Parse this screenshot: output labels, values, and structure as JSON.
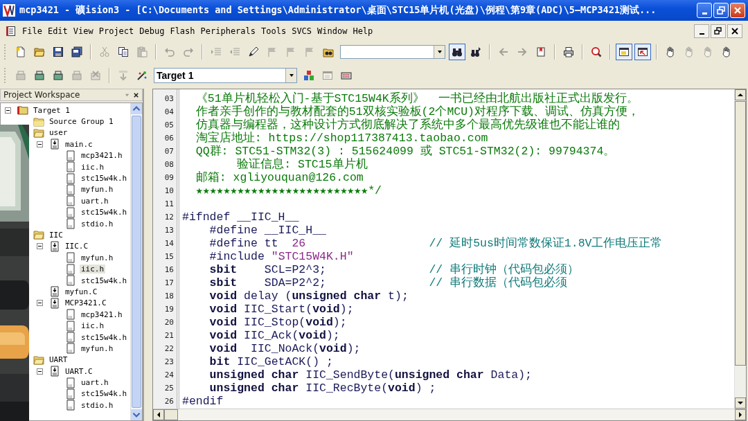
{
  "window": {
    "title": "mcp3421  - 礦ision3 - [C:\\Documents and Settings\\Administrator\\桌面\\STC15单片机(光盘)\\例程\\第9章(ADC)\\5—MCP3421测试..."
  },
  "menu": [
    "File",
    "Edit",
    "View",
    "Project",
    "Debug",
    "Flash",
    "Peripherals",
    "Tools",
    "SVCS",
    "Window",
    "Help"
  ],
  "toolbars": [
    [
      [
        {
          "kind": "new",
          "pressed": false,
          "disabled": false
        },
        {
          "kind": "open",
          "pressed": false,
          "disabled": false
        },
        {
          "kind": "save",
          "pressed": false,
          "disabled": false
        },
        {
          "kind": "saveall",
          "pressed": false,
          "disabled": false
        }
      ],
      [
        {
          "kind": "cut",
          "pressed": false,
          "disabled": true
        },
        {
          "kind": "copy",
          "pressed": false,
          "disabled": false
        },
        {
          "kind": "paste",
          "pressed": false,
          "disabled": true
        }
      ],
      [
        {
          "kind": "undo",
          "pressed": false,
          "disabled": true
        },
        {
          "kind": "redo",
          "pressed": false,
          "disabled": true
        }
      ],
      [
        {
          "kind": "indent",
          "pressed": false,
          "disabled": true
        },
        {
          "kind": "outdent",
          "pressed": false,
          "disabled": true
        },
        {
          "kind": "pen",
          "pressed": false,
          "disabled": false
        },
        {
          "kind": "flag",
          "pressed": false,
          "disabled": true
        },
        {
          "kind": "flag",
          "pressed": false,
          "disabled": true
        },
        {
          "kind": "flag",
          "pressed": false,
          "disabled": true
        },
        {
          "kind": "findfiles",
          "pressed": false,
          "disabled": false
        },
        {
          "kind": "combo"
        },
        {
          "kind": "find",
          "pressed": true,
          "disabled": false
        },
        {
          "kind": "findnext",
          "pressed": false,
          "disabled": false
        }
      ],
      [
        {
          "kind": "back",
          "pressed": false,
          "disabled": true
        },
        {
          "kind": "forward",
          "pressed": false,
          "disabled": true
        },
        {
          "kind": "book",
          "pressed": false,
          "disabled": false
        }
      ],
      [
        {
          "kind": "print",
          "pressed": false,
          "disabled": false
        }
      ],
      [
        {
          "kind": "debug",
          "pressed": false,
          "disabled": false
        }
      ],
      [
        {
          "kind": "window",
          "pressed": true,
          "disabled": false
        },
        {
          "kind": "window2",
          "pressed": true,
          "disabled": false
        }
      ],
      [
        {
          "kind": "hand",
          "pressed": false,
          "disabled": false
        },
        {
          "kind": "hand",
          "pressed": false,
          "disabled": true
        },
        {
          "kind": "hand",
          "pressed": false,
          "disabled": true
        },
        {
          "kind": "hand",
          "pressed": false,
          "disabled": false
        }
      ]
    ],
    [
      [
        {
          "kind": "build",
          "pressed": false,
          "disabled": true
        },
        {
          "kind": "build",
          "pressed": false,
          "disabled": false
        },
        {
          "kind": "build",
          "pressed": false,
          "disabled": false
        },
        {
          "kind": "build",
          "pressed": false,
          "disabled": true
        },
        {
          "kind": "stop",
          "pressed": false,
          "disabled": true
        }
      ],
      [
        {
          "kind": "load",
          "pressed": false,
          "disabled": true
        },
        {
          "kind": "wand",
          "pressed": false,
          "disabled": false
        },
        {
          "kind": "combo",
          "value": "Target 1"
        },
        {
          "kind": "blocks",
          "pressed": false,
          "disabled": false
        },
        {
          "kind": "window",
          "pressed": false,
          "disabled": true
        },
        {
          "kind": "keyboard",
          "pressed": false,
          "disabled": false
        }
      ]
    ]
  ],
  "workspace": {
    "title": "Project Workspace",
    "tree": [
      {
        "label": "Target 1",
        "kind": "target",
        "selected": false,
        "expanded": true,
        "children": [
          {
            "label": "Source Group 1",
            "kind": "group",
            "selected": false
          },
          {
            "label": "user",
            "kind": "group",
            "selected": false,
            "expanded": true,
            "children": [
              {
                "label": "main.c",
                "kind": "cfile",
                "selected": false,
                "expanded": true,
                "children": [
                  {
                    "label": "mcp3421.h",
                    "kind": "hfile",
                    "selected": false
                  },
                  {
                    "label": "iic.h",
                    "kind": "hfile",
                    "selected": false
                  },
                  {
                    "label": "stc15w4k.h",
                    "kind": "hfile",
                    "selected": false
                  },
                  {
                    "label": "myfun.h",
                    "kind": "hfile",
                    "selected": false
                  },
                  {
                    "label": "uart.h",
                    "kind": "hfile",
                    "selected": false
                  },
                  {
                    "label": "stc15w4k.h",
                    "kind": "hfile",
                    "selected": false
                  },
                  {
                    "label": "stdio.h",
                    "kind": "hfile",
                    "selected": false
                  }
                ]
              }
            ]
          },
          {
            "label": "IIC",
            "kind": "group",
            "selected": false,
            "expanded": true,
            "children": [
              {
                "label": "IIC.C",
                "kind": "cfile",
                "selected": false,
                "expanded": true,
                "children": [
                  {
                    "label": "myfun.h",
                    "kind": "hfile",
                    "selected": false
                  },
                  {
                    "label": "iic.h",
                    "kind": "hfile",
                    "selected": true
                  },
                  {
                    "label": "stc15w4k.h",
                    "kind": "hfile",
                    "selected": false
                  }
                ]
              },
              {
                "label": "myfun.C",
                "kind": "cfile",
                "selected": false
              },
              {
                "label": "MCP3421.C",
                "kind": "cfile",
                "selected": false,
                "expanded": true,
                "children": [
                  {
                    "label": "mcp3421.h",
                    "kind": "hfile",
                    "selected": false
                  },
                  {
                    "label": "iic.h",
                    "kind": "hfile",
                    "selected": false
                  },
                  {
                    "label": "stc15w4k.h",
                    "kind": "hfile",
                    "selected": false
                  },
                  {
                    "label": "myfun.h",
                    "kind": "hfile",
                    "selected": false
                  }
                ]
              }
            ]
          },
          {
            "label": "UART",
            "kind": "group",
            "selected": false,
            "expanded": true,
            "children": [
              {
                "label": "UART.C",
                "kind": "cfile",
                "selected": false,
                "expanded": true,
                "children": [
                  {
                    "label": "uart.h",
                    "kind": "hfile",
                    "selected": false
                  },
                  {
                    "label": "stc15w4k.h",
                    "kind": "hfile",
                    "selected": false
                  },
                  {
                    "label": "stdio.h",
                    "kind": "hfile",
                    "selected": false
                  }
                ]
              }
            ]
          }
        ]
      }
    ]
  },
  "overlay": {
    "kind": "picture"
  },
  "editor": {
    "lines": [
      {
        "number": "03",
        "tokens": [
          {
            "kind": "comment",
            "text": "  《51单片机轻松入门-基于STC15W4K系列》  一书已经由北航出版社正式出版发行。"
          }
        ]
      },
      {
        "number": "04",
        "tokens": [
          {
            "kind": "comment",
            "text": "  作者亲手创作的与教材配套的51双核实验板(2个MCU)对程序下载、调试、仿真方便，"
          }
        ]
      },
      {
        "number": "05",
        "tokens": [
          {
            "kind": "comment",
            "text": "  仿真器与编程器，这种设计方式彻底解决了系统中多个最高优先级谁也不能让谁的"
          }
        ]
      },
      {
        "number": "06",
        "tokens": [
          {
            "kind": "comment",
            "text": "  淘宝店地址: https://shop117387413.taobao.com"
          }
        ]
      },
      {
        "number": "07",
        "tokens": [
          {
            "kind": "comment",
            "text": "  QQ群: STC51-STM32(3) : 515624099 或 STC51-STM32(2): 99794374。"
          }
        ]
      },
      {
        "number": "08",
        "tokens": [
          {
            "kind": "comment",
            "text": "        验证信息: STC15单片机"
          }
        ]
      },
      {
        "number": "09",
        "tokens": [
          {
            "kind": "comment",
            "text": "  邮箱: xgliyouquan@126.com"
          }
        ]
      },
      {
        "number": "10",
        "tokens": [
          {
            "kind": "comment",
            "text": "  ★★★★★★★★★★★★★★★★★★★★★★★★★*/"
          }
        ]
      },
      {
        "number": "11"
      },
      {
        "number": "12",
        "tokens": [
          {
            "kind": "plain",
            "text": "#ifndef __IIC_H__"
          }
        ]
      },
      {
        "number": "13",
        "tokens": [
          {
            "kind": "plain",
            "text": "    #define __IIC_H__"
          }
        ]
      },
      {
        "number": "14",
        "tokens": [
          {
            "kind": "plain",
            "text": "    #define tt  "
          },
          {
            "kind": "number",
            "text": "26"
          },
          {
            "kind": "trail",
            "text": "// 延时5us时间常数保证1.8V工作电压正常"
          }
        ]
      },
      {
        "number": "15",
        "tokens": [
          {
            "kind": "plain",
            "text": "    #include "
          },
          {
            "kind": "string",
            "text": "\"STC15W4K.H\""
          }
        ]
      },
      {
        "number": "16",
        "tokens": [
          {
            "kind": "keyword",
            "text": "    sbit"
          },
          {
            "kind": "plain",
            "text": "    SCL=P2^3;"
          },
          {
            "kind": "trail",
            "text": "// 串行时钟（代码包必须）"
          }
        ]
      },
      {
        "number": "17",
        "tokens": [
          {
            "kind": "keyword",
            "text": "    sbit"
          },
          {
            "kind": "plain",
            "text": "    SDA=P2^2;"
          },
          {
            "kind": "trail",
            "text": "// 串行数据（代码包必须"
          }
        ]
      },
      {
        "number": "18",
        "tokens": [
          {
            "kind": "keyword",
            "text": "    void"
          },
          {
            "kind": "plain",
            "text": " delay ("
          },
          {
            "kind": "keyword",
            "text": "unsigned char"
          },
          {
            "kind": "plain",
            "text": " t);"
          }
        ]
      },
      {
        "number": "19",
        "tokens": [
          {
            "kind": "keyword",
            "text": "    void"
          },
          {
            "kind": "plain",
            "text": " IIC_Start("
          },
          {
            "kind": "keyword",
            "text": "void"
          },
          {
            "kind": "plain",
            "text": ");"
          }
        ]
      },
      {
        "number": "20",
        "tokens": [
          {
            "kind": "keyword",
            "text": "    void"
          },
          {
            "kind": "plain",
            "text": " IIC_Stop("
          },
          {
            "kind": "keyword",
            "text": "void"
          },
          {
            "kind": "plain",
            "text": ");"
          }
        ]
      },
      {
        "number": "21",
        "tokens": [
          {
            "kind": "keyword",
            "text": "    void"
          },
          {
            "kind": "plain",
            "text": " IIC_Ack("
          },
          {
            "kind": "keyword",
            "text": "void"
          },
          {
            "kind": "plain",
            "text": ");"
          }
        ]
      },
      {
        "number": "22",
        "tokens": [
          {
            "kind": "keyword",
            "text": "    void"
          },
          {
            "kind": "plain",
            "text": "  IIC_NoAck("
          },
          {
            "kind": "keyword",
            "text": "void"
          },
          {
            "kind": "plain",
            "text": ");"
          }
        ]
      },
      {
        "number": "23",
        "tokens": [
          {
            "kind": "keyword",
            "text": "    bit"
          },
          {
            "kind": "plain",
            "text": " IIC_GetACK() ;"
          }
        ]
      },
      {
        "number": "24",
        "tokens": [
          {
            "kind": "keyword",
            "text": "    unsigned char"
          },
          {
            "kind": "plain",
            "text": " IIC_SendByte("
          },
          {
            "kind": "keyword",
            "text": "unsigned char"
          },
          {
            "kind": "plain",
            "text": " Data);"
          }
        ]
      },
      {
        "number": "25",
        "tokens": [
          {
            "kind": "keyword",
            "text": "    unsigned char"
          },
          {
            "kind": "plain",
            "text": " IIC_RecByte("
          },
          {
            "kind": "keyword",
            "text": "void"
          },
          {
            "kind": "plain",
            "text": ") ;"
          }
        ]
      },
      {
        "number": "26",
        "tokens": [
          {
            "kind": "plain",
            "text": "#endif"
          }
        ]
      }
    ]
  }
}
